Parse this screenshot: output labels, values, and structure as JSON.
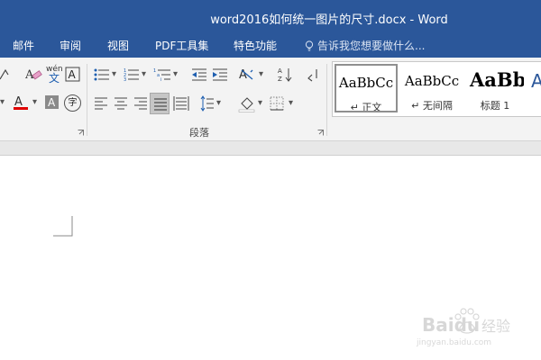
{
  "window": {
    "title": "word2016如何统一图片的尺寸.docx - Word"
  },
  "menu": {
    "tabs": [
      "邮件",
      "审阅",
      "视图",
      "PDF工具集",
      "特色功能"
    ],
    "tell_me": "告诉我您想要做什么..."
  },
  "ribbon": {
    "font_group": {
      "phonetic_guide_glyph": "wén",
      "phonetic_guide_char": "文",
      "enclose_char": "字"
    },
    "paragraph_group": {
      "label": "段落"
    },
    "styles": [
      {
        "sample": "AaBbCc",
        "name": "正文",
        "selected": true
      },
      {
        "sample": "AaBbCc",
        "name": "无间隔",
        "selected": false
      },
      {
        "sample": "AaBb",
        "name": "标题 1",
        "selected": false
      }
    ]
  },
  "watermark": {
    "brand": "Baidu",
    "brand_cn": "经验",
    "url": "jingyan.baidu.com"
  },
  "colors": {
    "accent": "#2b579a",
    "ribbon": "#f3f3f3",
    "font_color_underline": "#e00000"
  }
}
